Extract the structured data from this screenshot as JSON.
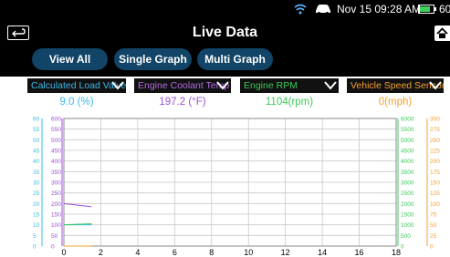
{
  "status_bar": {
    "datetime": "Nov 15  09:28 AM",
    "battery_text": "60"
  },
  "header": {
    "title": "Live Data"
  },
  "tabs": [
    {
      "label": "View All"
    },
    {
      "label": "Single Graph"
    },
    {
      "label": "Multi Graph"
    }
  ],
  "sensors": [
    {
      "name": "Calculated Load Valve",
      "value": "9.0 (%)",
      "color": "#3ab8e8"
    },
    {
      "name": "Engine Coolant Temp",
      "value": "197.2 (°F)",
      "color": "#9b4fd6"
    },
    {
      "name": "Engine RPM",
      "value": "1104(rpm)",
      "color": "#3cc85a"
    },
    {
      "name": "Vehicle Speed Sensor",
      "value": "0(mph)",
      "color": "#f5a030"
    }
  ],
  "chart_data": {
    "type": "line",
    "x_ticks": [
      "0",
      "2",
      "4",
      "6",
      "8",
      "10",
      "12",
      "14",
      "16",
      "18"
    ],
    "xlim": [
      0,
      18
    ],
    "axes": [
      {
        "series": "Calculated Load Valve",
        "color": "#3ab8e8",
        "ticks": [
          "0",
          "5",
          "10",
          "15",
          "20",
          "25",
          "30",
          "35",
          "40",
          "45",
          "50",
          "55",
          "60"
        ],
        "ylim": [
          0,
          60
        ]
      },
      {
        "series": "Engine Coolant Temp",
        "color": "#9b4fd6",
        "ticks": [
          "0",
          "50",
          "100",
          "150",
          "200",
          "250",
          "300",
          "350",
          "400",
          "450",
          "500",
          "550",
          "600"
        ],
        "ylim": [
          0,
          600
        ]
      },
      {
        "series": "Engine RPM",
        "color": "#3cc85a",
        "ticks": [
          "0",
          "500",
          "1000",
          "1500",
          "2000",
          "2500",
          "3000",
          "3500",
          "4000",
          "4500",
          "5000",
          "5500",
          "6000"
        ],
        "ylim": [
          0,
          6000
        ]
      },
      {
        "series": "Vehicle Speed Sensor",
        "color": "#f5a030",
        "ticks": [
          "0",
          "25",
          "50",
          "75",
          "100",
          "125",
          "150",
          "175",
          "200",
          "225",
          "250",
          "275",
          "300"
        ],
        "ylim": [
          0,
          300
        ]
      }
    ],
    "series": [
      {
        "name": "Calculated Load Valve",
        "color": "#3ab8e8",
        "x": [
          0,
          1.5
        ],
        "y": [
          10,
          10
        ]
      },
      {
        "name": "Engine Coolant Temp",
        "color": "#9b4fd6",
        "x": [
          0,
          1.5
        ],
        "y": [
          200,
          185
        ]
      },
      {
        "name": "Engine RPM",
        "color": "#3cc85a",
        "x": [
          0,
          1.5
        ],
        "y": [
          1000,
          1050
        ]
      },
      {
        "name": "Vehicle Speed Sensor",
        "color": "#f5a030",
        "x": [
          0,
          1.5
        ],
        "y": [
          0,
          0
        ]
      }
    ]
  }
}
